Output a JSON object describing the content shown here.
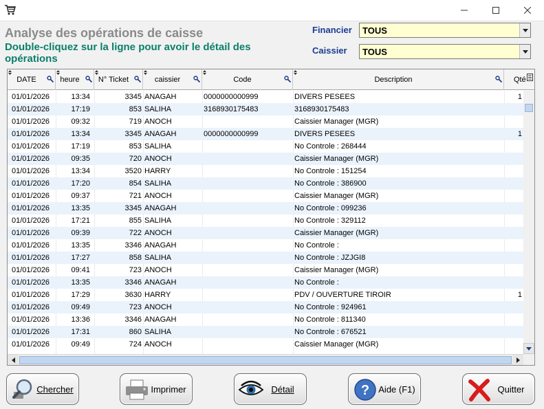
{
  "header": {
    "title": "Analyse des opérations de caisse",
    "subtitle": "Double-cliquez sur la ligne pour avoir le détail des opérations"
  },
  "filters": {
    "financier": {
      "label": "Financier",
      "value": "TOUS"
    },
    "caissier": {
      "label": "Caissier",
      "value": "TOUS"
    }
  },
  "grid": {
    "columns": [
      "DATE",
      "heure",
      "N° Ticket",
      "caissier",
      "Code",
      "Description",
      "Qté"
    ],
    "rows": [
      [
        "01/01/2026",
        "13:34",
        "3345",
        "ANAGAH",
        "0000000000999",
        "DIVERS PESEES",
        "1"
      ],
      [
        "01/01/2026",
        "17:19",
        "853",
        "SALIHA",
        "3168930175483",
        "3168930175483",
        ""
      ],
      [
        "01/01/2026",
        "09:32",
        "719",
        "ANOCH",
        "",
        "Caissier Manager (MGR)",
        ""
      ],
      [
        "01/01/2026",
        "13:34",
        "3345",
        "ANAGAH",
        "0000000000999",
        "DIVERS PESEES",
        "1"
      ],
      [
        "01/01/2026",
        "17:19",
        "853",
        "SALIHA",
        "",
        "No Controle : 268444",
        ""
      ],
      [
        "01/01/2026",
        "09:35",
        "720",
        "ANOCH",
        "",
        "Caissier Manager (MGR)",
        ""
      ],
      [
        "01/01/2026",
        "13:34",
        "3520",
        "HARRY",
        "",
        "No Controle : 151254",
        ""
      ],
      [
        "01/01/2026",
        "17:20",
        "854",
        "SALIHA",
        "",
        "No Controle : 386900",
        ""
      ],
      [
        "01/01/2026",
        "09:37",
        "721",
        "ANOCH",
        "",
        "Caissier Manager (MGR)",
        ""
      ],
      [
        "01/01/2026",
        "13:35",
        "3345",
        "ANAGAH",
        "",
        "No Controle : 099236",
        ""
      ],
      [
        "01/01/2026",
        "17:21",
        "855",
        "SALIHA",
        "",
        "No Controle : 329112",
        ""
      ],
      [
        "01/01/2026",
        "09:39",
        "722",
        "ANOCH",
        "",
        "Caissier Manager (MGR)",
        ""
      ],
      [
        "01/01/2026",
        "13:35",
        "3346",
        "ANAGAH",
        "",
        "No Controle :",
        ""
      ],
      [
        "01/01/2026",
        "17:27",
        "858",
        "SALIHA",
        "",
        "No Controle : JZJGI8",
        ""
      ],
      [
        "01/01/2026",
        "09:41",
        "723",
        "ANOCH",
        "",
        "Caissier Manager (MGR)",
        ""
      ],
      [
        "01/01/2026",
        "13:35",
        "3346",
        "ANAGAH",
        "",
        "No Controle :",
        ""
      ],
      [
        "01/01/2026",
        "17:29",
        "3630",
        "HARRY",
        "",
        "PDV / OUVERTURE TIROIR",
        "1"
      ],
      [
        "01/01/2026",
        "09:49",
        "723",
        "ANOCH",
        "",
        "No Controle : 924961",
        ""
      ],
      [
        "01/01/2026",
        "13:36",
        "3346",
        "ANAGAH",
        "",
        "No Controle : 811340",
        ""
      ],
      [
        "01/01/2026",
        "17:31",
        "860",
        "SALIHA",
        "",
        "No Controle : 676521",
        ""
      ],
      [
        "01/01/2026",
        "09:49",
        "724",
        "ANOCH",
        "",
        "Caissier Manager (MGR)",
        ""
      ]
    ]
  },
  "buttons": {
    "chercher": "Chercher",
    "imprimer": "Imprimer",
    "detail": "Détail",
    "aide": "Aide (F1)",
    "quitter": "Quitter"
  },
  "icons": {
    "app": "cart-icon",
    "chercher": "magnifier-icon",
    "imprimer": "printer-icon",
    "detail": "eye-icon",
    "aide": "help-icon",
    "quitter": "red-cross-icon"
  },
  "colors": {
    "title_gray": "#8a8a8a",
    "subtitle_teal": "#0a7f6b",
    "filter_label_blue": "#1a3c92",
    "combo_background": "#ffffd2",
    "alt_row": "#eaf3fc"
  }
}
